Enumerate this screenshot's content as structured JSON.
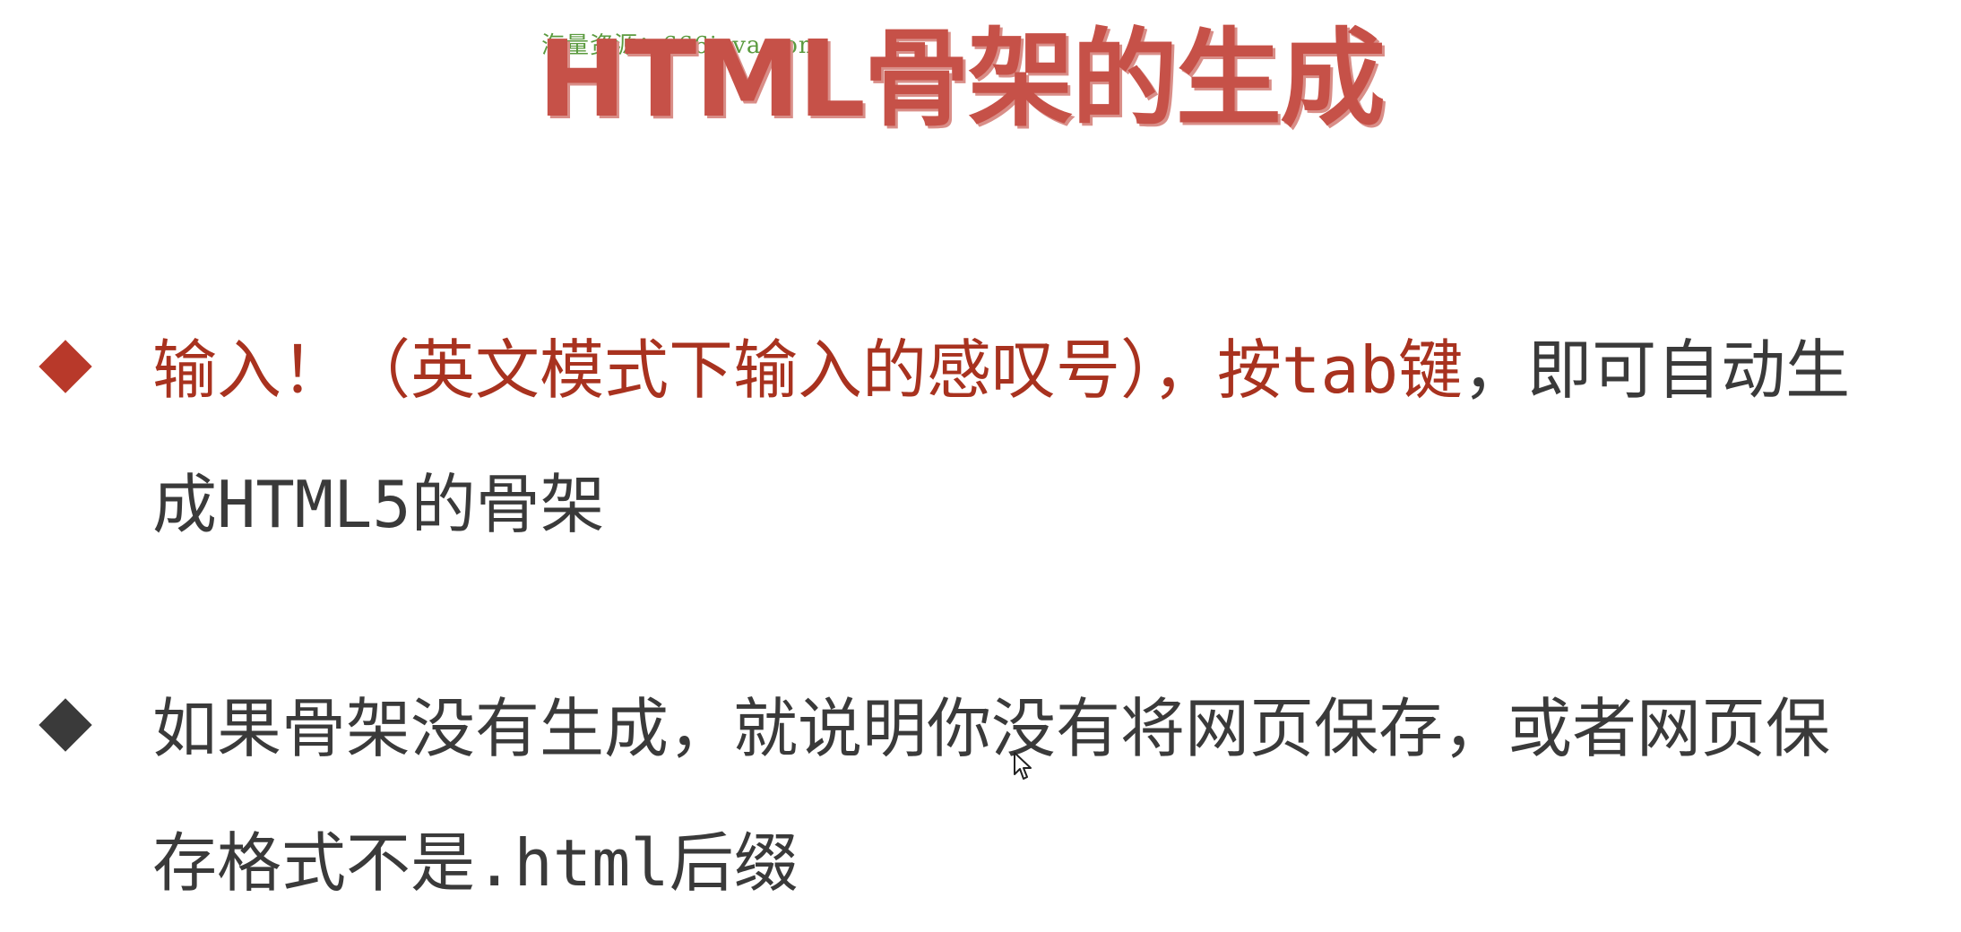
{
  "watermark": "海量资源：666java.com",
  "title": "HTML骨架的生成",
  "bullets": [
    {
      "marker_color": "#b8392a",
      "parts": {
        "p1": "输入！（英文模式下输入的感叹号），按",
        "p2": "tab",
        "p3": "键",
        "p4": "，即可自动生成",
        "p5": "HTML5",
        "p6": "的骨架"
      }
    },
    {
      "marker_color": "#3a3a3a",
      "parts": {
        "p1": "如果骨架没有生成，就说明你没有将网页保存，或者网页保存格式不是",
        "p2": ".html",
        "p3": "后缀"
      }
    }
  ],
  "colors": {
    "title": "#c65148",
    "highlight": "#a8321f",
    "body_text": "#3a3a3a"
  },
  "icons": {
    "bullet": "diamond-bullet-icon",
    "cursor": "mouse-pointer-icon"
  }
}
